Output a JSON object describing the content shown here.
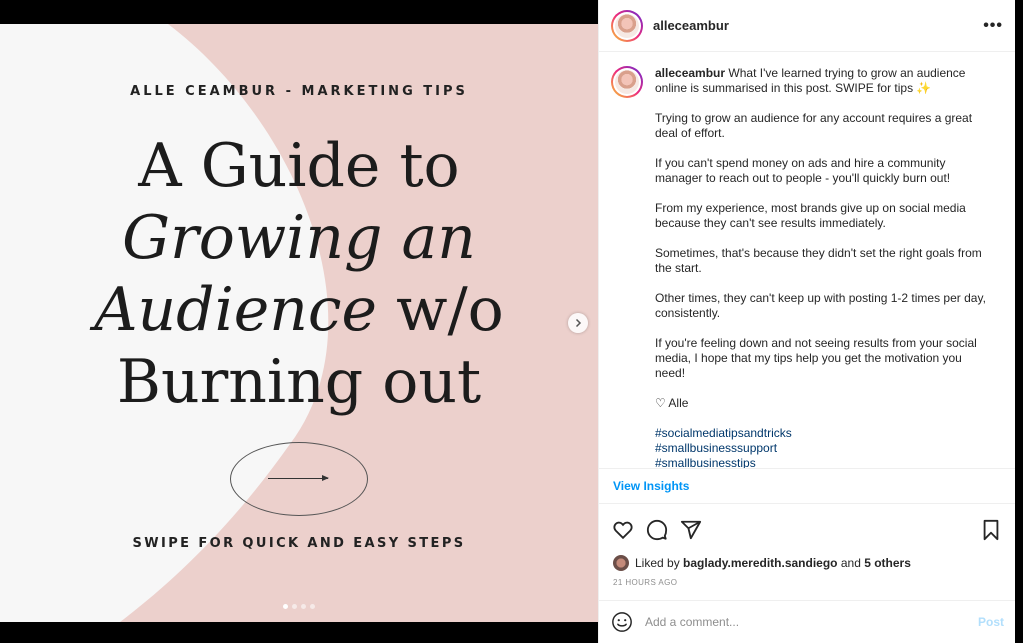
{
  "post": {
    "slide": {
      "kicker": "ALLE CEAMBUR - MARKETING TIPS",
      "title_line1": "A Guide to",
      "title_line2": "Growing an",
      "title_line3a": "Audience",
      "title_line3b": " w/o",
      "title_line4": "Burning out",
      "cta": "SWIPE FOR QUICK AND EASY STEPS",
      "colors": {
        "background": "#ecd0cc",
        "shape": "#f7f7f7",
        "text": "#1c1c1c"
      }
    },
    "carousel": {
      "current": 1,
      "total": 4,
      "next_icon": "chevron-right-icon"
    }
  },
  "header": {
    "username": "alleceambur",
    "more_icon": "more-horizontal-icon"
  },
  "caption": {
    "username": "alleceambur",
    "intro": "What I've learned trying to grow an audience online is summarised in this post. SWIPE for tips ✨",
    "paragraphs": [
      "Trying to grow an audience for any account requires a great deal of effort.",
      "If you can't spend money on ads and hire a community manager to reach out to people - you'll quickly burn out!",
      "From my experience, most brands give up on social media because they can't see results immediately.",
      "Sometimes, that's because they didn't set the right goals from the start.",
      "Other times, they can't keep up with posting 1-2 times per day, consistently.",
      "If you're feeling down and not seeing results from your social media, I hope that my tips help you get the motivation you need!",
      "♡ Alle"
    ],
    "hashtags": [
      "#socialmediatipsandtricks",
      "#smallbusinesssupport",
      "#smallbusinesstips"
    ]
  },
  "insights": {
    "label": "View Insights"
  },
  "actions": {
    "icons": [
      "heart-icon",
      "comment-icon",
      "share-icon",
      "bookmark-icon"
    ]
  },
  "likes": {
    "prefix": "Liked by ",
    "user": "baglady.meredith.sandiego",
    "middle": " and ",
    "others": "5 others"
  },
  "timestamp": "21 HOURS AGO",
  "comment": {
    "placeholder": "Add a comment...",
    "post_label": "Post",
    "emoji_icon": "smiley-icon"
  }
}
